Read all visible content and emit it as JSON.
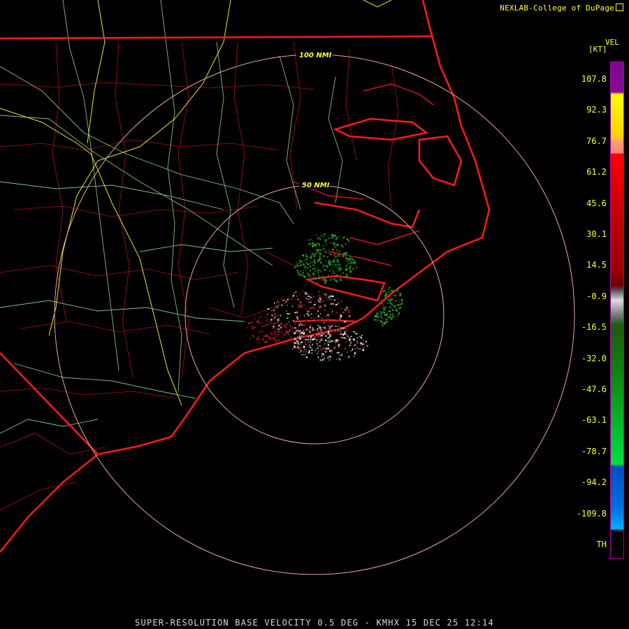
{
  "credit": "NEXLAB-College of DuPage",
  "legend": {
    "name": "VEL",
    "unit": "[KT]",
    "ticks": [
      "107.8",
      "92.3",
      "76.7",
      "61.2",
      "45.6",
      "30.1",
      "14.5",
      "-0.9",
      "-16.5",
      "-32.0",
      "-47.6",
      "-63.1",
      "-78.7",
      "-94.2",
      "-109.8",
      "TH"
    ]
  },
  "rings": [
    {
      "label": "100 NMI"
    },
    {
      "label": "50 NMI"
    }
  ],
  "footer": "SUPER-RESOLUTION BASE VELOCITY 0.5 DEG - KMHX 15 DEC 25 12:14",
  "colors": {
    "state_border": "#ff1a1a",
    "county_lines": "#cc1414",
    "roads_green": "#8fd48f",
    "roads_yellow": "#e6e633",
    "ring": "#e8a8a0",
    "text": "#ffff33"
  }
}
